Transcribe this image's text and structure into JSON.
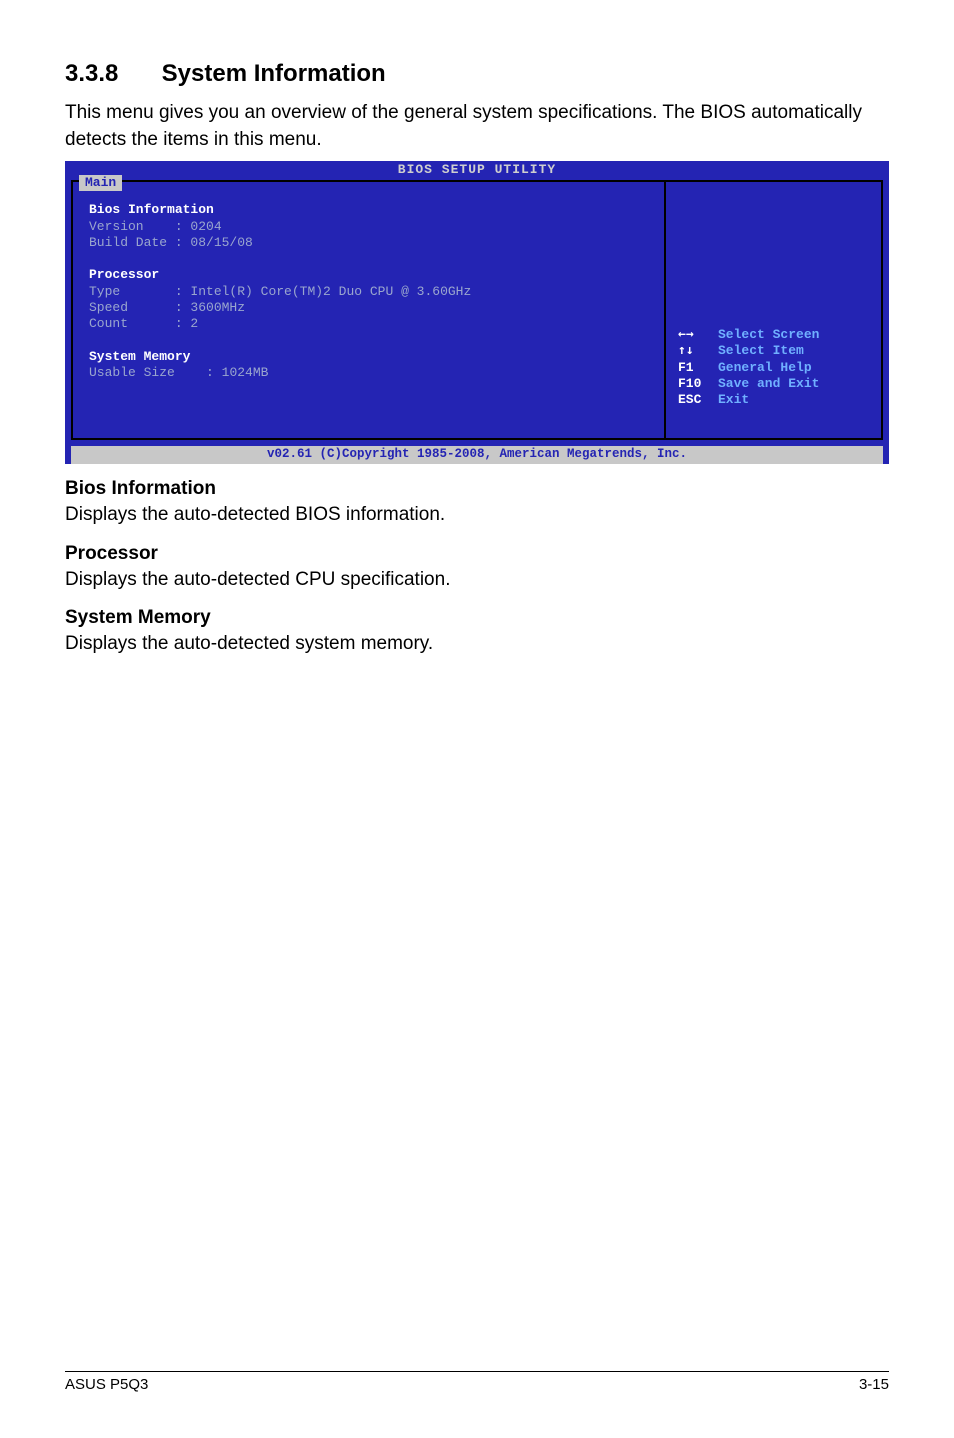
{
  "heading": {
    "number": "3.3.8",
    "title": "System Information"
  },
  "intro": "This menu gives you an overview of the general system specifications. The BIOS automatically detects the items in this menu.",
  "bios": {
    "title": "BIOS SETUP UTILITY",
    "tab": "Main",
    "footer": "v02.61 (C)Copyright 1985-2008, American Megatrends, Inc.",
    "sections": {
      "bios_info": {
        "header": "Bios Information",
        "version_label": "Version",
        "version": ": 0204",
        "build_label": "Build Date",
        "build": ": 08/15/08"
      },
      "processor": {
        "header": "Processor",
        "type_label": "Type",
        "type": ": Intel(R) Core(TM)2 Duo CPU @ 3.60GHz",
        "speed_label": "Speed",
        "speed": ": 3600MHz",
        "count_label": "Count",
        "count": ": 2"
      },
      "memory": {
        "header": "System Memory",
        "usable_label": "Usable Size",
        "usable": ": 1024MB"
      }
    },
    "help": {
      "k1": "←→",
      "v1": "Select Screen",
      "k2": "↑↓",
      "v2": "Select Item",
      "k3": "F1",
      "v3": "General Help",
      "k4": "F10",
      "v4": "Save and Exit",
      "k5": "ESC",
      "v5": "Exit"
    }
  },
  "doc_sections": {
    "s1h": "Bios Information",
    "s1p": "Displays the auto-detected BIOS information.",
    "s2h": "Processor",
    "s2p": "Displays the auto-detected CPU specification.",
    "s3h": "System Memory",
    "s3p": "Displays the auto-detected system memory."
  },
  "footer": {
    "left": "ASUS P5Q3",
    "right": "3-15"
  }
}
